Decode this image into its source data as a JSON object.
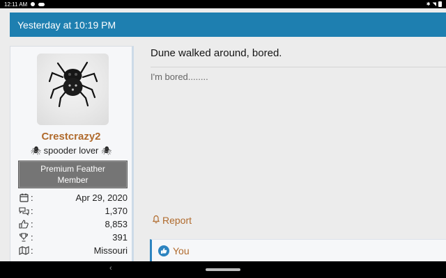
{
  "status_bar": {
    "time": "12:11 AM"
  },
  "post": {
    "timestamp": "Yesterday at 10:19 PM",
    "title": "Dune walked around, bored.",
    "body": "I'm bored........",
    "report_label": "Report",
    "reactions_label": "You"
  },
  "user": {
    "name": "Crestcrazy2",
    "title": "spooder lover",
    "title_decoration": "🕷",
    "banner": "Premium Feather Member",
    "stats": [
      {
        "icon": "calendar-icon",
        "value": "Apr 29, 2020"
      },
      {
        "icon": "messages-icon",
        "value": "1,370"
      },
      {
        "icon": "thumbs-up-icon",
        "value": "8,853"
      },
      {
        "icon": "trophy-icon",
        "value": "391"
      },
      {
        "icon": "map-icon",
        "value": "Missouri"
      }
    ]
  },
  "colors": {
    "header_blue": "#1e7fb0",
    "username_brown": "#b06a2c",
    "banner_gray": "#757575",
    "like_blue": "#2d84c0"
  }
}
